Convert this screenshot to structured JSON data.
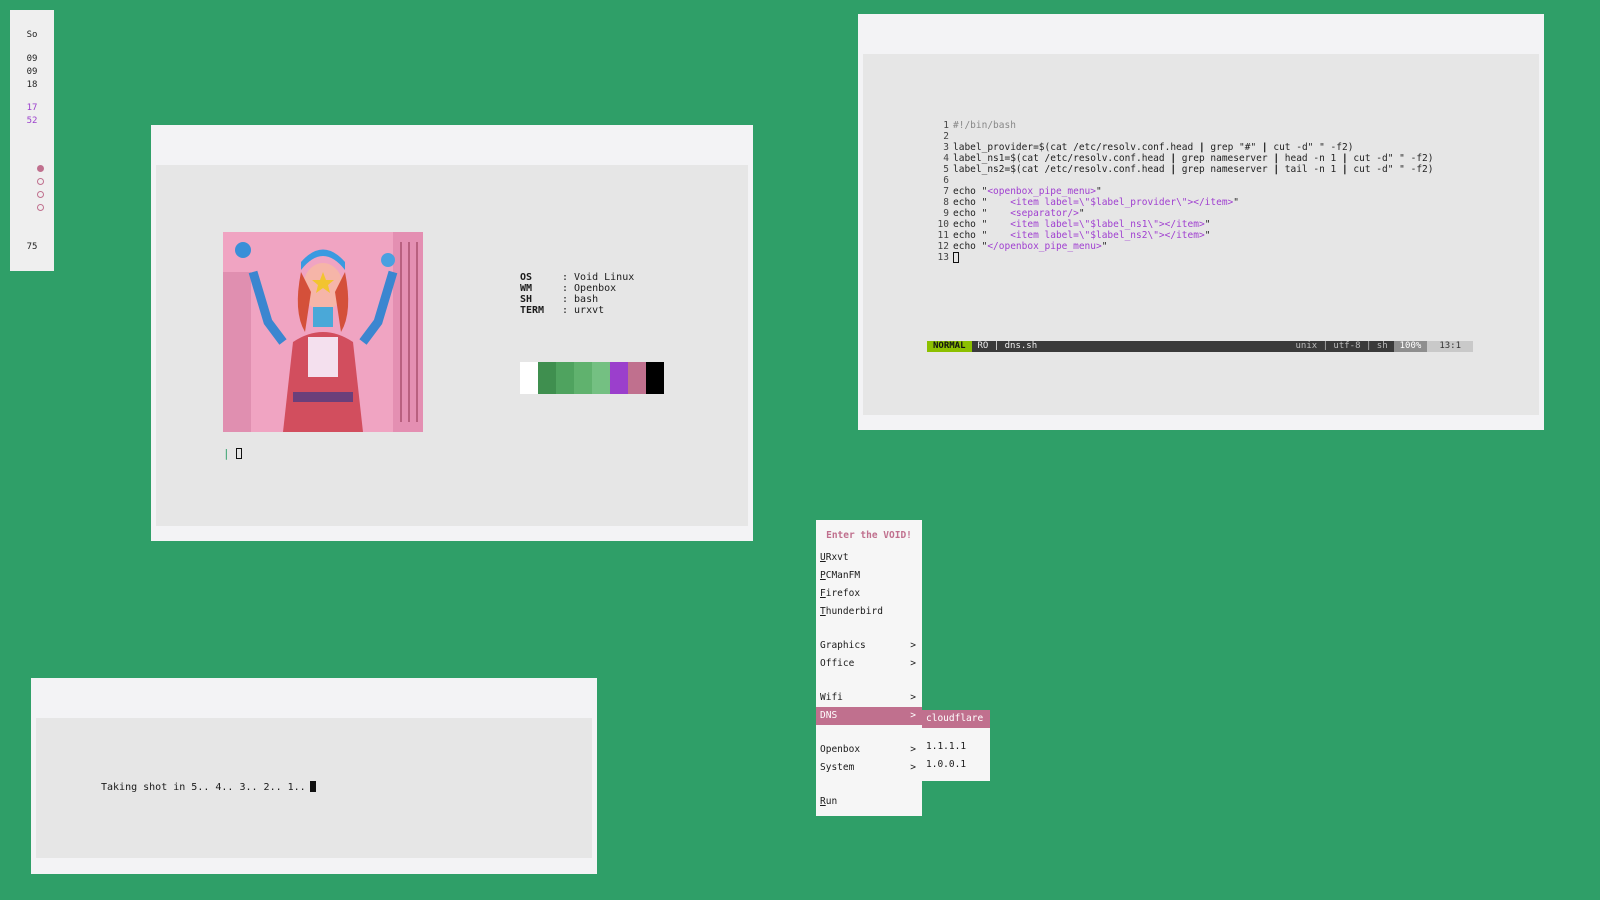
{
  "bar": {
    "day": "So",
    "date": [
      "09",
      "09",
      "18"
    ],
    "time": [
      "17",
      "52"
    ],
    "workspaces": [
      true,
      false,
      false,
      false
    ],
    "volume": "75"
  },
  "fetch": {
    "rows": [
      {
        "key": "OS",
        "value": ": Void Linux"
      },
      {
        "key": "WM",
        "value": ": Openbox"
      },
      {
        "key": "SH",
        "value": ": bash"
      },
      {
        "key": "TERM",
        "value": ": urxvt"
      }
    ],
    "palette": [
      "#ffffff",
      "#3f8f4f",
      "#4fa35f",
      "#60b26e",
      "#74c082",
      "#9b3fcc",
      "#c0708e",
      "#000000"
    ],
    "prompt_symbol": "|"
  },
  "editor": {
    "lines": [
      "#!/bin/bash",
      "",
      "label_provider=$(cat /etc/resolv.conf.head | grep \"#\" | cut -d\" \" -f2)",
      "label_ns1=$(cat /etc/resolv.conf.head | grep nameserver | head -n 1 | cut -d\" \" -f2)",
      "label_ns2=$(cat /etc/resolv.conf.head | grep nameserver | tail -n 1 | cut -d\" \" -f2)",
      "",
      "echo \"<openbox_pipe_menu>\"",
      "echo \"    <item label=\\\"$label_provider\\\"></item>\"",
      "echo \"    <separator/>\"",
      "echo \"    <item label=\\\"$label_ns1\\\"></item>\"",
      "echo \"    <item label=\\\"$label_ns2\\\"></item>\"",
      "echo \"</openbox_pipe_menu>\"",
      ""
    ],
    "status": {
      "mode": "NORMAL",
      "file": "RO | dns.sh",
      "enc": "unix | utf-8 | sh",
      "pct": "100%",
      "pos": "13:1"
    }
  },
  "shot": {
    "text": "Taking shot in 5.. 4.. 3.. 2.. 1.."
  },
  "menu": {
    "title": "Enter the VOID!",
    "items": [
      {
        "label": "URxvt",
        "sub": false
      },
      {
        "label": "PCManFM",
        "sub": false
      },
      {
        "label": "Firefox",
        "sub": false
      },
      {
        "label": "Thunderbird",
        "sub": false
      },
      {
        "label": "Graphics",
        "sub": true
      },
      {
        "label": "Office",
        "sub": true
      },
      {
        "label": "Wifi",
        "sub": true
      },
      {
        "label": "DNS",
        "sub": true
      },
      {
        "label": "Openbox",
        "sub": true
      },
      {
        "label": "System",
        "sub": true
      },
      {
        "label": "Run",
        "sub": false
      }
    ],
    "arrow": ">",
    "submenu": [
      "cloudflare",
      "1.1.1.1",
      "1.0.0.1"
    ]
  }
}
